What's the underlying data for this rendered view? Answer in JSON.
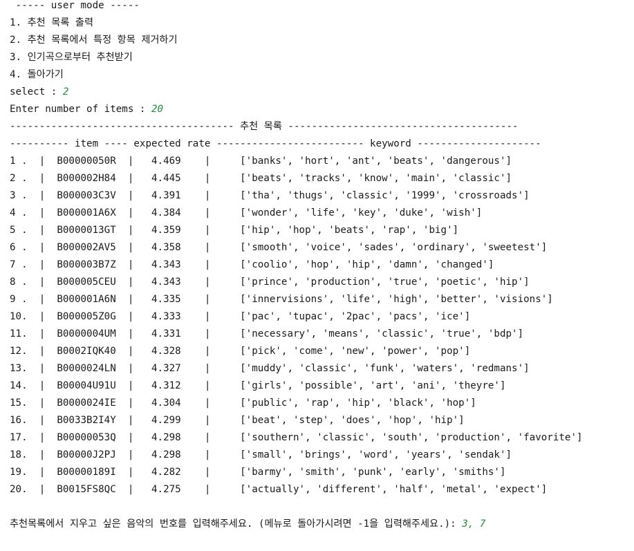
{
  "menu": {
    "header": " ----- user mode -----",
    "items": [
      "1. 추천 목록 출력",
      "2. 추천 목록에서 특정 항목 제거하기",
      "3. 인기곡으로부터 추천받기",
      "4. 돌아가기"
    ]
  },
  "prompts": {
    "select_label": "select : ",
    "select_value": "2",
    "items_label": "Enter number of items : ",
    "items_value": "20"
  },
  "table": {
    "title_line": "-------------------------------------- 추천 목록 ---------------------------------------",
    "header_line": "---------- item ---- expected rate ------------------------- keyword ---------------------",
    "rows": [
      "1 .  |  B00000050R  |   4.469    |     ['banks', 'hort', 'ant', 'beats', 'dangerous']",
      "2 .  |  B000002H84  |   4.445    |     ['beats', 'tracks', 'know', 'main', 'classic']",
      "3 .  |  B000003C3V  |   4.391    |     ['tha', 'thugs', 'classic', '1999', 'crossroads']",
      "4 .  |  B000001A6X  |   4.384    |     ['wonder', 'life', 'key', 'duke', 'wish']",
      "5 .  |  B0000013GT  |   4.359    |     ['hip', 'hop', 'beats', 'rap', 'big']",
      "6 .  |  B000002AV5  |   4.358    |     ['smooth', 'voice', 'sades', 'ordinary', 'sweetest']",
      "7 .  |  B000003B7Z  |   4.343    |     ['coolio', 'hop', 'hip', 'damn', 'changed']",
      "8 .  |  B000005CEU  |   4.343    |     ['prince', 'production', 'true', 'poetic', 'hip']",
      "9 .  |  B000001A6N  |   4.335    |     ['innervisions', 'life', 'high', 'better', 'visions']",
      "10.  |  B000005Z0G  |   4.333    |     ['pac', 'tupac', '2pac', 'pacs', 'ice']",
      "11.  |  B0000004UM  |   4.331    |     ['necessary', 'means', 'classic', 'true', 'bdp']",
      "12.  |  B0002IQK40  |   4.328    |     ['pick', 'come', 'new', 'power', 'pop']",
      "13.  |  B0000024LN  |   4.327    |     ['muddy', 'classic', 'funk', 'waters', 'redmans']",
      "14.  |  B00004U91U  |   4.312    |     ['girls', 'possible', 'art', 'ani', 'theyre']",
      "15.  |  B0000024IE  |   4.304    |     ['public', 'rap', 'hip', 'black', 'hop']",
      "16.  |  B0033B2I4Y  |   4.299    |     ['beat', 'step', 'does', 'hop', 'hip']",
      "17.  |  B00000053Q  |   4.298    |     ['southern', 'classic', 'south', 'production', 'favorite']",
      "18.  |  B00000J2PJ  |   4.298    |     ['small', 'brings', 'word', 'years', 'sendak']",
      "19.  |  B00000189I  |   4.282    |     ['barmy', 'smith', 'punk', 'early', 'smiths']",
      "20.  |  B0015FS8QC  |   4.275    |     ['actually', 'different', 'half', 'metal', 'expect']"
    ]
  },
  "delete_prompt": {
    "label": "추천목록에서 지우고 싶은 음악의 번호를 입력해주세요. (메뉴로 돌아가시려면 -1을 입력해주세요.): ",
    "value": "3, 7"
  }
}
